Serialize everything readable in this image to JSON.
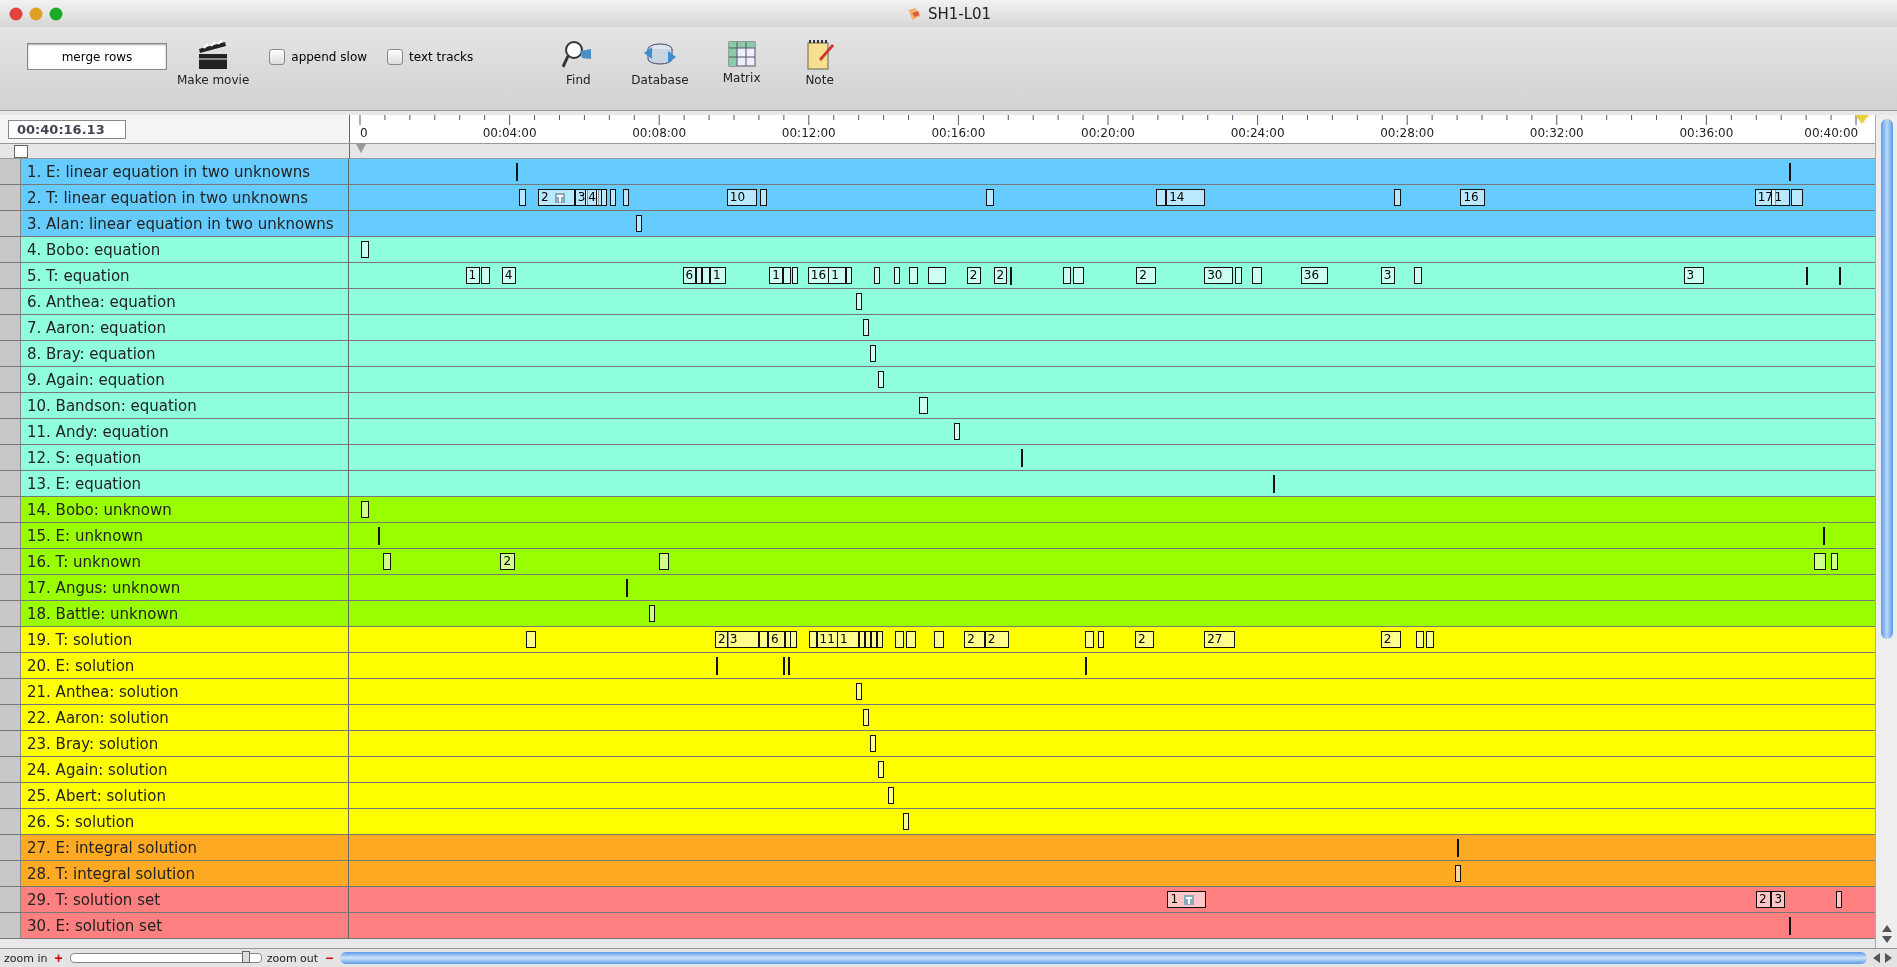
{
  "window": {
    "title": "SH1-L01"
  },
  "toolbar": {
    "merge_button": "merge rows",
    "make_movie": "Make movie",
    "checkboxes": [
      {
        "label": "append slow",
        "checked": false
      },
      {
        "label": "text tracks",
        "checked": false
      }
    ],
    "tools": [
      {
        "kind": "find",
        "label": "Find"
      },
      {
        "kind": "database",
        "label": "Database"
      },
      {
        "kind": "matrix",
        "label": "Matrix"
      },
      {
        "kind": "note",
        "label": "Note"
      }
    ]
  },
  "timecode": "00:40:16.13",
  "select_all": {
    "checked": false
  },
  "ruler": [
    "0",
    "00:04:00",
    "00:08:00",
    "00:12:00",
    "00:16:00",
    "00:20:00",
    "00:24:00",
    "00:28:00",
    "00:32:00",
    "00:36:00",
    "00:40:00"
  ],
  "rows": [
    {
      "label": "1. E: linear equation in two unknowns",
      "color": "#66ccff",
      "events": [
        {
          "kind": "tick"
        },
        {
          "kind": "tick"
        }
      ]
    },
    {
      "label": "2. T: linear equation in two unknowns",
      "color": "#66ccff",
      "events": [
        {
          "kind": "box"
        },
        {
          "kind": "box",
          "label": "2",
          "badge": true
        },
        {
          "kind": "box",
          "label": "3"
        },
        {
          "kind": "box",
          "label": "4"
        },
        {
          "kind": "box"
        },
        {
          "kind": "box"
        },
        {
          "kind": "box"
        },
        {
          "kind": "box"
        },
        {
          "kind": "box",
          "label": "10"
        },
        {
          "kind": "box"
        },
        {
          "kind": "box"
        },
        {
          "kind": "box"
        },
        {
          "kind": "box",
          "label": "14"
        },
        {
          "kind": "box"
        },
        {
          "kind": "box",
          "label": "16"
        },
        {
          "kind": "box",
          "label": "17"
        },
        {
          "kind": "box",
          "label": "1"
        },
        {
          "kind": "box"
        }
      ]
    },
    {
      "label": "3. Alan: linear equation in two unknowns",
      "color": "#66ccff",
      "events": [
        {
          "kind": "box"
        }
      ]
    },
    {
      "label": "4. Bobo: equation",
      "color": "#8fffdd",
      "events": [
        {
          "kind": "box"
        }
      ]
    },
    {
      "label": "5. T: equation",
      "color": "#8fffdd",
      "events": [
        {
          "kind": "box",
          "label": "1"
        },
        {
          "kind": "box"
        },
        {
          "kind": "box",
          "label": "4"
        },
        {
          "kind": "box",
          "label": "6"
        },
        {
          "kind": "box"
        },
        {
          "kind": "box"
        },
        {
          "kind": "box",
          "label": "1"
        },
        {
          "kind": "box",
          "label": "1"
        },
        {
          "kind": "box"
        },
        {
          "kind": "box"
        },
        {
          "kind": "box",
          "label": "16"
        },
        {
          "kind": "box",
          "label": "1"
        },
        {
          "kind": "box"
        },
        {
          "kind": "box"
        },
        {
          "kind": "box"
        },
        {
          "kind": "box"
        },
        {
          "kind": "box"
        },
        {
          "kind": "box",
          "label": "2"
        },
        {
          "kind": "box",
          "label": "2"
        },
        {
          "kind": "tick"
        },
        {
          "kind": "box"
        },
        {
          "kind": "box"
        },
        {
          "kind": "box",
          "label": "2"
        },
        {
          "kind": "box",
          "label": "30"
        },
        {
          "kind": "box"
        },
        {
          "kind": "box"
        },
        {
          "kind": "box",
          "label": "36"
        },
        {
          "kind": "box",
          "label": "3"
        },
        {
          "kind": "box"
        },
        {
          "kind": "box",
          "label": "3"
        },
        {
          "kind": "tick"
        },
        {
          "kind": "tick"
        }
      ]
    },
    {
      "label": "6. Anthea: equation",
      "color": "#8fffdd",
      "events": [
        {
          "kind": "box"
        }
      ]
    },
    {
      "label": "7. Aaron: equation",
      "color": "#8fffdd",
      "events": [
        {
          "kind": "box"
        }
      ]
    },
    {
      "label": "8. Bray: equation",
      "color": "#8fffdd",
      "events": [
        {
          "kind": "box"
        }
      ]
    },
    {
      "label": "9. Again: equation",
      "color": "#8fffdd",
      "events": [
        {
          "kind": "box"
        }
      ]
    },
    {
      "label": "10. Bandson: equation",
      "color": "#8fffdd",
      "events": [
        {
          "kind": "box"
        }
      ]
    },
    {
      "label": "11. Andy: equation",
      "color": "#8fffdd",
      "events": [
        {
          "kind": "box"
        }
      ]
    },
    {
      "label": "12. S: equation",
      "color": "#8fffdd",
      "events": [
        {
          "kind": "tick"
        }
      ]
    },
    {
      "label": "13. E: equation",
      "color": "#8fffdd",
      "events": [
        {
          "kind": "tick"
        }
      ]
    },
    {
      "label": "14. Bobo: unknown",
      "color": "#99ff00",
      "events": [
        {
          "kind": "box"
        }
      ]
    },
    {
      "label": "15. E: unknown",
      "color": "#99ff00",
      "events": [
        {
          "kind": "tick"
        },
        {
          "kind": "tick"
        }
      ]
    },
    {
      "label": "16. T: unknown",
      "color": "#99ff00",
      "events": [
        {
          "kind": "box"
        },
        {
          "kind": "box",
          "label": "2"
        },
        {
          "kind": "box"
        },
        {
          "kind": "box"
        },
        {
          "kind": "box"
        }
      ]
    },
    {
      "label": "17. Angus: unknown",
      "color": "#99ff00",
      "events": [
        {
          "kind": "tick"
        }
      ]
    },
    {
      "label": "18. Battle: unknown",
      "color": "#99ff00",
      "events": [
        {
          "kind": "box"
        }
      ]
    },
    {
      "label": "19. T: solution",
      "color": "#ffff00",
      "events": [
        {
          "kind": "box"
        },
        {
          "kind": "box",
          "label": "2"
        },
        {
          "kind": "box",
          "label": "3"
        },
        {
          "kind": "box"
        },
        {
          "kind": "box",
          "label": "6"
        },
        {
          "kind": "box"
        },
        {
          "kind": "box"
        },
        {
          "kind": "box"
        },
        {
          "kind": "box",
          "label": "11"
        },
        {
          "kind": "box",
          "label": "1"
        },
        {
          "kind": "box"
        },
        {
          "kind": "box"
        },
        {
          "kind": "box"
        },
        {
          "kind": "box"
        },
        {
          "kind": "box"
        },
        {
          "kind": "box"
        },
        {
          "kind": "box"
        },
        {
          "kind": "box",
          "label": "2"
        },
        {
          "kind": "box",
          "label": "2"
        },
        {
          "kind": "box"
        },
        {
          "kind": "box"
        },
        {
          "kind": "box",
          "label": "2"
        },
        {
          "kind": "box",
          "label": "27"
        },
        {
          "kind": "box",
          "label": "2"
        },
        {
          "kind": "box"
        },
        {
          "kind": "box"
        }
      ]
    },
    {
      "label": "20. E: solution",
      "color": "#ffff00",
      "events": [
        {
          "kind": "tick"
        },
        {
          "kind": "tick"
        },
        {
          "kind": "tick"
        },
        {
          "kind": "tick"
        }
      ]
    },
    {
      "label": "21. Anthea: solution",
      "color": "#ffff00",
      "events": [
        {
          "kind": "box"
        }
      ]
    },
    {
      "label": "22. Aaron: solution",
      "color": "#ffff00",
      "events": [
        {
          "kind": "box"
        }
      ]
    },
    {
      "label": "23. Bray: solution",
      "color": "#ffff00",
      "events": [
        {
          "kind": "box"
        }
      ]
    },
    {
      "label": "24. Again: solution",
      "color": "#ffff00",
      "events": [
        {
          "kind": "box"
        }
      ]
    },
    {
      "label": "25. Abert: solution",
      "color": "#ffff00",
      "events": [
        {
          "kind": "box"
        }
      ]
    },
    {
      "label": "26. S: solution",
      "color": "#ffff00",
      "events": [
        {
          "kind": "box"
        }
      ]
    },
    {
      "label": "27. E: integral solution",
      "color": "#ffaa22",
      "events": [
        {
          "kind": "tick"
        }
      ]
    },
    {
      "label": "28. T: integral solution",
      "color": "#ffaa22",
      "events": [
        {
          "kind": "box"
        }
      ]
    },
    {
      "label": "29. T: solution set",
      "color": "#ff8080",
      "events": [
        {
          "kind": "box",
          "label": "1",
          "badge": true
        },
        {
          "kind": "box",
          "label": "2"
        },
        {
          "kind": "box",
          "label": "3"
        },
        {
          "kind": "box"
        }
      ]
    },
    {
      "label": "30. E: solution set",
      "color": "#ff8080",
      "events": [
        {
          "kind": "tick"
        }
      ]
    }
  ],
  "zoom": {
    "zoom_in": "zoom in",
    "plus": "+",
    "zoom_out": "zoom out",
    "minus": "−",
    "level": 0.93
  }
}
